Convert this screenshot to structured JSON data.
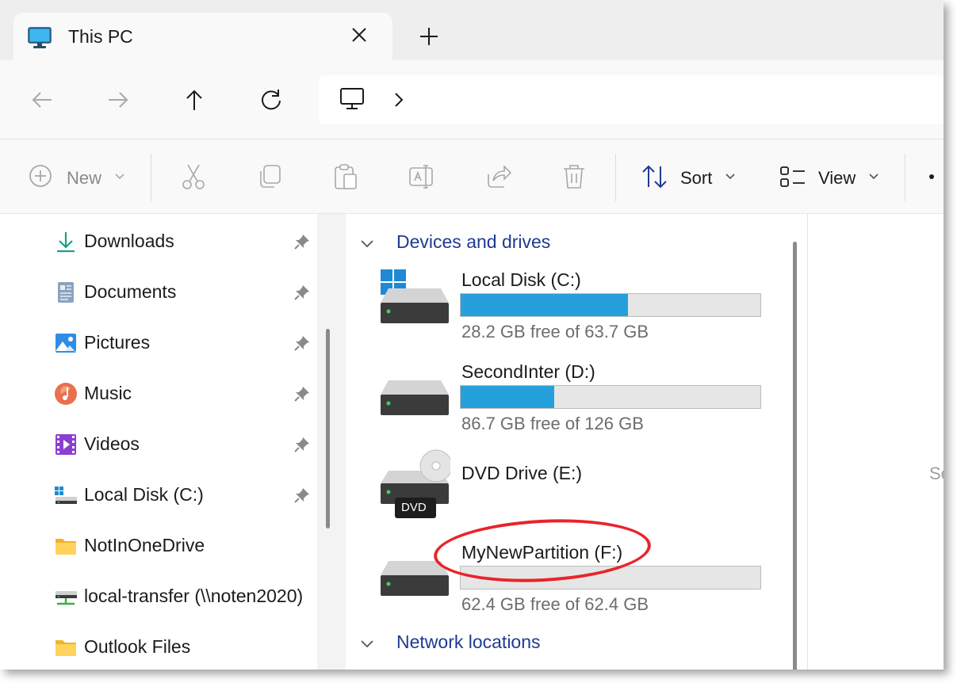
{
  "window": {
    "tab_title": "This PC",
    "tab_icon": "monitor-icon"
  },
  "address": {
    "location_icon": "this-pc-icon"
  },
  "commands": {
    "new_label": "New",
    "sort_label": "Sort",
    "view_label": "View",
    "icons": [
      "cut-icon",
      "copy-icon",
      "paste-icon",
      "rename-icon",
      "share-icon",
      "delete-icon"
    ]
  },
  "navigation": {
    "items": [
      {
        "label": "Downloads",
        "icon": "downloads-icon",
        "pinned": true
      },
      {
        "label": "Documents",
        "icon": "documents-icon",
        "pinned": true
      },
      {
        "label": "Pictures",
        "icon": "pictures-icon",
        "pinned": true
      },
      {
        "label": "Music",
        "icon": "music-icon",
        "pinned": true
      },
      {
        "label": "Videos",
        "icon": "videos-icon",
        "pinned": true
      },
      {
        "label": "Local Disk (C:)",
        "icon": "local-disk-icon",
        "pinned": true
      },
      {
        "label": "NotInOneDrive",
        "icon": "folder-icon",
        "pinned": false
      },
      {
        "label": "local-transfer (\\\\noten2020)",
        "icon": "network-drive-icon",
        "pinned": false
      },
      {
        "label": "Outlook Files",
        "icon": "folder-icon",
        "pinned": false
      }
    ]
  },
  "content": {
    "devices_heading": "Devices and drives",
    "network_heading": "Network locations",
    "drives": [
      {
        "name": "Local Disk (C:)",
        "free_text": "28.2 GB free of 63.7 GB",
        "used_fraction": 0.557
      },
      {
        "name": "SecondInter (D:)",
        "free_text": "86.7 GB free of 126 GB",
        "used_fraction": 0.312
      },
      {
        "name": "DVD Drive (E:)",
        "badge": "DVD"
      },
      {
        "name": "MyNewPartition (F:)",
        "free_text": "62.4 GB free of 62.4 GB",
        "used_fraction": 0.0
      }
    ],
    "details_partial": "Se"
  },
  "colors": {
    "accent": "#26a0da",
    "heading": "#1f3a93",
    "highlight": "#e8242b"
  }
}
